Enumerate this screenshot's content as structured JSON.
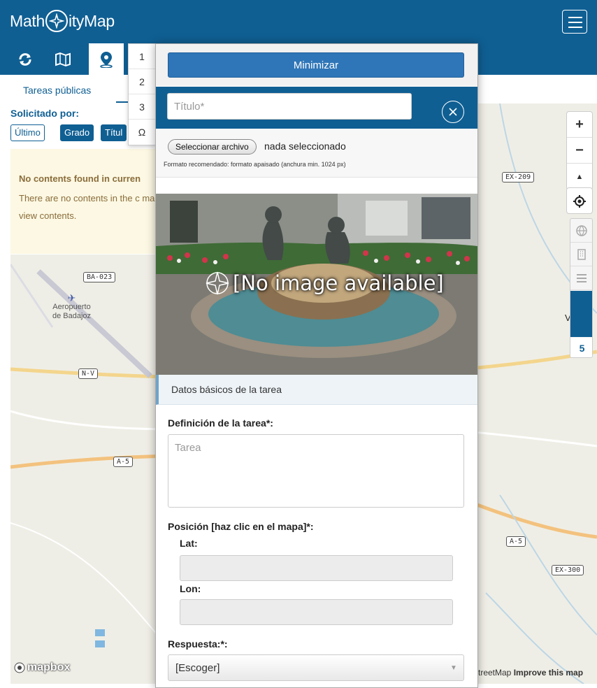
{
  "header": {
    "logo_prefix": "Math",
    "logo_suffix": "ityMap",
    "brand_color": "#0f5f93"
  },
  "toolbar": {
    "icons": [
      "refresh-icon",
      "map-icon",
      "location-pin-icon"
    ]
  },
  "left_panel": {
    "tab_label": "Tareas públicas",
    "sort_label": "Solicitado por:",
    "sort_buttons": [
      "Último",
      "Grado",
      "Títul"
    ],
    "notice_title": "No contents found in curren",
    "notice_text": "There are no contents in the c map. Enlarge the visible part a view contents."
  },
  "number_menu": {
    "items": [
      "1",
      "2",
      "3",
      "Ω"
    ]
  },
  "map": {
    "road_labels": [
      "BA-023",
      "N-V",
      "A-5",
      "EX-209",
      "A-5",
      "EX-300"
    ],
    "place_label_1": "Aeropuerto",
    "place_label_2": "de Badajoz",
    "partial_label": "V",
    "zoom_in": "+",
    "zoom_out": "−",
    "compass": "▲",
    "layer_count": "5",
    "mapbox": "mapbox",
    "attribution_text": "treetMap ",
    "attribution_link": "Improve this map"
  },
  "modal": {
    "minimize_label": "Minimizar",
    "title_placeholder": "Título*",
    "file_button": "Seleccionar archivo",
    "file_status": "nada seleccionado",
    "file_hint": "Formato recomendado: formato apaisado (anchura min. 1024 px)",
    "no_image_text": "[No image available]",
    "section_title": "Datos básicos de la tarea",
    "definition_label": "Definición de la tarea*:",
    "definition_placeholder": "Tarea",
    "position_label": "Posición [haz clic en el mapa]*:",
    "lat_label": "Lat:",
    "lon_label": "Lon:",
    "answer_label": "Respuesta:*:",
    "answer_select_value": "[Escoger]"
  }
}
